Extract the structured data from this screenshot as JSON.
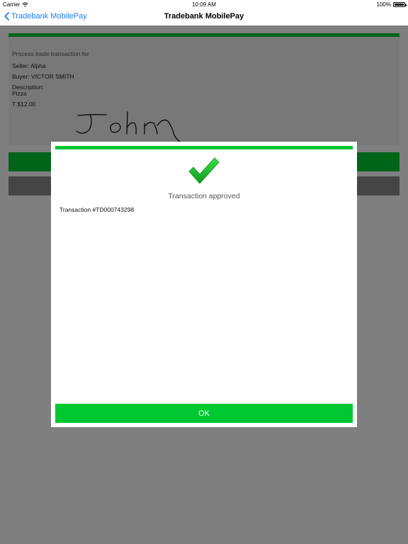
{
  "status_bar": {
    "carrier": "Carrier",
    "time": "10:09 AM",
    "battery": "100%"
  },
  "nav": {
    "back_label": "Tradebank MobilePay",
    "title": "Tradebank MobilePay"
  },
  "transaction": {
    "heading": "Process trade transaction for",
    "seller": "Seller: Alpha",
    "buyer": "Buyer: VICTOR SMITH",
    "description_label": "Description:",
    "description_value": "Pizza",
    "amount": "T $12.00"
  },
  "dialog": {
    "status": "Transaction approved",
    "transaction_number": "Transaction #TD000743298",
    "ok_label": "OK"
  },
  "colors": {
    "accent_green": "#00c832",
    "link_blue": "#1a7ef5",
    "cancel_gray": "#8a8a8a"
  }
}
